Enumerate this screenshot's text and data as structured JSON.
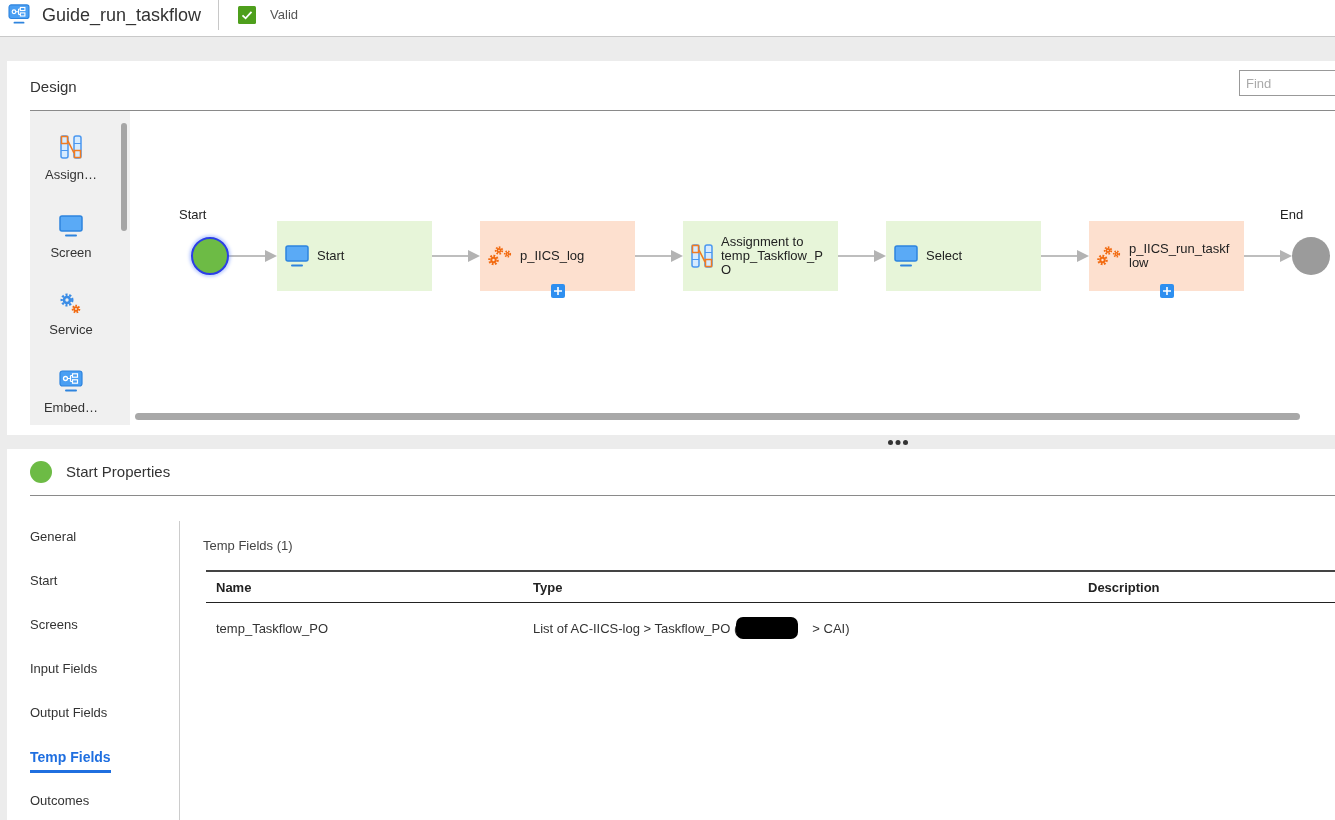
{
  "header": {
    "title": "Guide_run_taskflow",
    "status": {
      "label": "Valid",
      "valid": true
    }
  },
  "design": {
    "title": "Design",
    "find": {
      "placeholder": "Find"
    },
    "palette": [
      {
        "label": "Assign…",
        "kind": "assignment"
      },
      {
        "label": "Screen",
        "kind": "screen"
      },
      {
        "label": "Service",
        "kind": "service"
      },
      {
        "label": "Embed…",
        "kind": "embedded"
      }
    ],
    "flow": {
      "start": {
        "label": "Start",
        "selected": true
      },
      "steps": [
        {
          "label": "Start",
          "kind": "screen",
          "plus_button": false
        },
        {
          "label": "p_IICS_log",
          "kind": "service",
          "plus_button": true
        },
        {
          "label": "Assignment to temp_Taskflow_PO",
          "kind": "assignment",
          "plus_button": false
        },
        {
          "label": "Select",
          "kind": "screen",
          "plus_button": false
        },
        {
          "label": "p_IICS_run_taskflow",
          "kind": "service",
          "plus_button": true
        }
      ],
      "end": {
        "label": "End"
      }
    }
  },
  "properties": {
    "title": "Start Properties",
    "nav": [
      {
        "label": "General",
        "selected": false
      },
      {
        "label": "Start",
        "selected": false
      },
      {
        "label": "Screens",
        "selected": false
      },
      {
        "label": "Input Fields",
        "selected": false
      },
      {
        "label": "Output Fields",
        "selected": false
      },
      {
        "label": "Temp Fields",
        "selected": true
      },
      {
        "label": "Outcomes",
        "selected": false
      }
    ],
    "section_title": "Temp Fields (1)",
    "table": {
      "columns": [
        "Name",
        "Type",
        "Description"
      ],
      "rows": [
        {
          "name": "temp_Taskflow_PO",
          "type": {
            "before": "List of AC-IICS-log > Taskflow_PO (",
            "redacted": true,
            "after": "> CAI)"
          }
        }
      ]
    }
  }
}
